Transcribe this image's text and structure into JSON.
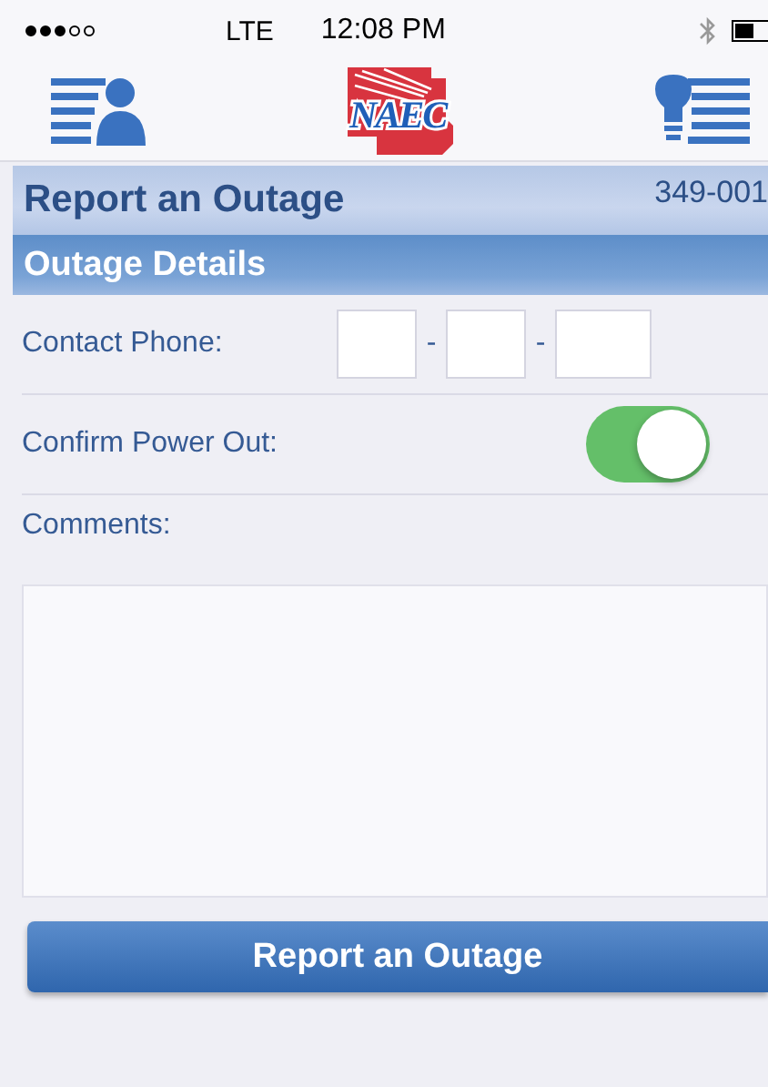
{
  "status_bar": {
    "carrier": "LTE",
    "time": "12:08 PM"
  },
  "nav": {
    "logo_text": "NAEC"
  },
  "title_bar": {
    "title": "Report an Outage",
    "account": "349-001"
  },
  "section": {
    "title": "Outage Details"
  },
  "form": {
    "phone_label": "Contact Phone:",
    "phone_separators": [
      "-",
      "-"
    ],
    "confirm_label": "Confirm Power Out:",
    "confirm_on": true,
    "comments_label": "Comments:"
  },
  "submit_button": "Report an Outage"
}
